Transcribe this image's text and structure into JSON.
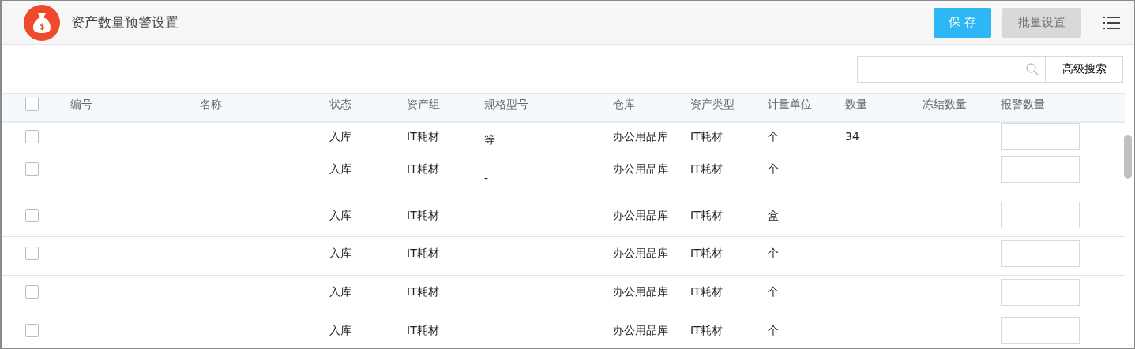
{
  "header": {
    "title": "资产数量预警设置",
    "buttons": [
      {
        "label": "保 存",
        "disabled": false
      },
      {
        "label": "批量设置",
        "disabled": true
      }
    ]
  },
  "search": {
    "button": "高级搜索"
  },
  "table": {
    "select_all": {
      "checked": false
    },
    "columns": [
      "编号",
      "名称",
      "状态",
      "资产组",
      "规格型号",
      "仓库",
      "资产类型",
      "计量单位",
      "数量",
      "冻结数量",
      "报警数量"
    ],
    "rows": [
      {
        "checked": false,
        "status": "入库",
        "group": "IT耗材",
        "spec": "等",
        "warehouse": "办公用品库",
        "type": "IT耗材",
        "unit": "个",
        "quantity": "34"
      },
      {
        "checked": false,
        "status": "入库",
        "group": "IT耗材",
        "spec": "-",
        "warehouse": "办公用品库",
        "type": "IT耗材",
        "unit": "个"
      },
      {
        "checked": false,
        "status": "入库",
        "group": "IT耗材",
        "warehouse": "办公用品库",
        "type": "IT耗材",
        "unit": "盒"
      },
      {
        "checked": false,
        "status": "入库",
        "group": "IT耗材",
        "warehouse": "办公用品库",
        "type": "IT耗材",
        "unit": "个"
      },
      {
        "checked": false,
        "status": "入库",
        "group": "IT耗材",
        "warehouse": "办公用品库",
        "type": "IT耗材",
        "unit": "个"
      },
      {
        "checked": false,
        "status": "入库",
        "group": "IT耗材",
        "warehouse": "办公用品库",
        "type": "IT耗材",
        "unit": "个"
      }
    ]
  }
}
